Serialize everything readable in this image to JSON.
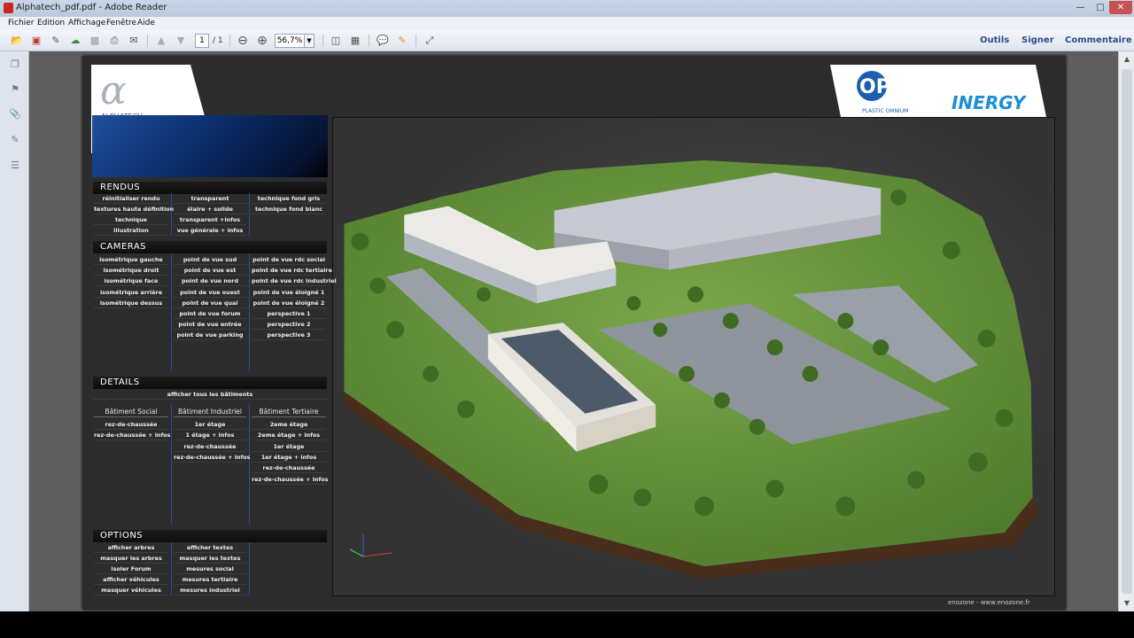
{
  "window": {
    "title": "Alphatech_pdf.pdf - Adobe Reader",
    "minimize": "—",
    "maximize": "□",
    "close": "✕"
  },
  "menu": [
    "Fichier",
    "Edition",
    "Affichage",
    "Fenêtre",
    "Aide"
  ],
  "toolbar": {
    "page_current": "1",
    "page_total": "/ 1",
    "zoom": "56,7%",
    "right": [
      "Outils",
      "Signer",
      "Commentaire"
    ],
    "icons": [
      "open-icon",
      "create-icon",
      "edit-icon",
      "upload-icon",
      "save-icon",
      "print-icon",
      "email-icon",
      "prev-page-icon",
      "next-page-icon",
      "zoom-out-icon",
      "zoom-in-icon",
      "fit-page-icon",
      "fit-width-icon",
      "comment-icon",
      "highlight-icon",
      "fullscreen-icon"
    ]
  },
  "logos": {
    "left_name": "ALPHATECH",
    "right_name": "PLASTIC OMNIUM",
    "right_brand": "INERGY",
    "right_mark": "OP"
  },
  "sections": {
    "rendus": {
      "title": "RENDUS",
      "cols": [
        [
          "réinitialiser rendu",
          "textures haute définition",
          "technique",
          "illustration"
        ],
        [
          "transparent",
          "élaire + solide",
          "transparent +infos",
          "vue générale + infos"
        ],
        [
          "technique fond gris",
          "technique fond blanc"
        ]
      ]
    },
    "cameras": {
      "title": "CAMERAS",
      "cols": [
        [
          "isométrique gauche",
          "isométrique droit",
          "isométrique face",
          "isométrique arrière",
          "isométrique dessus"
        ],
        [
          "point de vue sud",
          "point de vue est",
          "point de vue nord",
          "point de vue ouest",
          "point de vue quai",
          "point de vue forum",
          "point de vue entrée",
          "point de vue parking"
        ],
        [
          "point de vue rdc social",
          "point de vue rdc tertiaire",
          "point de vue rdc industriel",
          "point de vue éloigné 1",
          "point de vue éloigné 2",
          "perspective 1",
          "perspective 2",
          "perspective 3"
        ]
      ]
    },
    "details": {
      "title": "DETAILS",
      "all": "afficher tous les bâtiments",
      "heads": [
        "Bâtiment Social",
        "Bâtiment Industriel",
        "Bâtiment Tertiaire"
      ],
      "cols": [
        [
          "rez-de-chaussée",
          "rez-de-chaussée + infos"
        ],
        [
          "1er étage",
          "1 étage + infos",
          "rez-de-chaussée",
          "rez-de-chaussée + infos"
        ],
        [
          "2eme étage",
          "2eme étage + infos",
          "1er étage",
          "1er étage + infos",
          "rez-de-chaussée",
          "rez-de-chaussée + infos"
        ]
      ]
    },
    "options": {
      "title": "OPTIONS",
      "cols": [
        [
          "afficher arbres",
          "masquer les arbres",
          "isoler Forum",
          "afficher véhicules",
          "masquer véhicules"
        ],
        [
          "afficher textes",
          "masquer les textes",
          "mesures social",
          "mesures tertiaire",
          "mesures industriel"
        ]
      ]
    }
  },
  "credit": "enozone - www.enozone.fr"
}
